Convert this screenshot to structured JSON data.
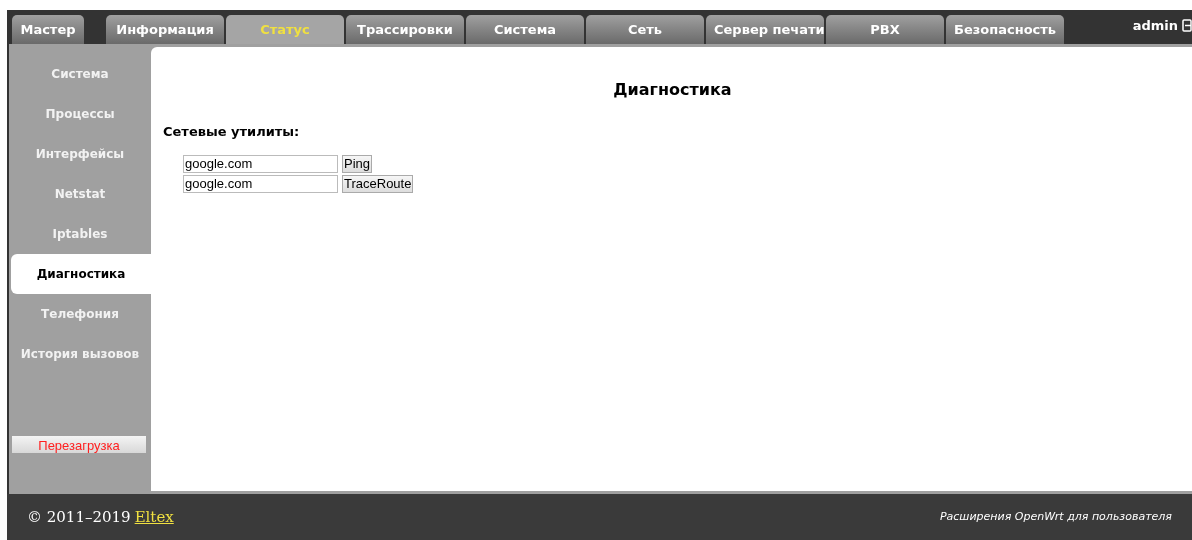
{
  "tabs": [
    {
      "label": "Мастер",
      "selected": false
    },
    {
      "label": "Информация",
      "selected": false
    },
    {
      "label": "Статус",
      "selected": true
    },
    {
      "label": "Трассировки",
      "selected": false
    },
    {
      "label": "Система",
      "selected": false
    },
    {
      "label": "Сеть",
      "selected": false
    },
    {
      "label": "Сервер печати",
      "selected": false
    },
    {
      "label": "PBX",
      "selected": false
    },
    {
      "label": "Безопасность",
      "selected": false
    }
  ],
  "user": "admin",
  "sidebar": {
    "items": [
      {
        "label": "Система",
        "selected": false
      },
      {
        "label": "Процессы",
        "selected": false
      },
      {
        "label": "Интерфейсы",
        "selected": false
      },
      {
        "label": "Netstat",
        "selected": false
      },
      {
        "label": "Iptables",
        "selected": false
      },
      {
        "label": "Диагностика",
        "selected": true
      },
      {
        "label": "Телефония",
        "selected": false
      },
      {
        "label": "История вызовов",
        "selected": false
      }
    ],
    "reboot_button": "Перезагрузка"
  },
  "page": {
    "title": "Диагностика",
    "section": "Сетевые утилиты:",
    "tools": [
      {
        "value": "google.com",
        "button": "Ping"
      },
      {
        "value": "google.com",
        "button": "TraceRoute"
      }
    ]
  },
  "footer": {
    "copyright": "© 2011–2019",
    "link": "Eltex",
    "note": "Расширения OpenWrt для пользователя"
  }
}
